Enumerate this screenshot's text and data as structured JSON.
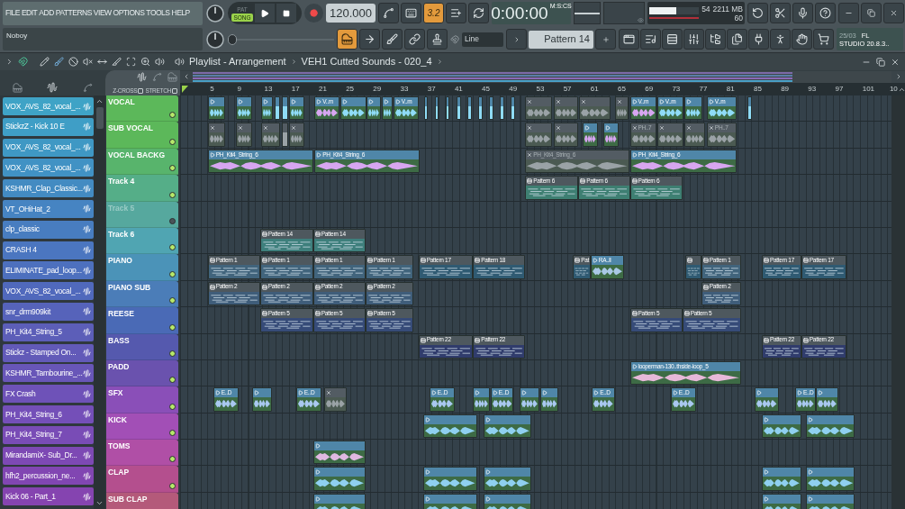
{
  "menu": [
    "FILE",
    "EDIT",
    "ADD",
    "PATTERNS",
    "VIEW",
    "OPTIONS",
    "TOOLS",
    "HELP"
  ],
  "hint_bar": {
    "text": "Noboy"
  },
  "transport": {
    "modes": [
      {
        "label": "PAT",
        "selected": false
      },
      {
        "label": "SONG",
        "selected": true
      }
    ],
    "tempo": "120.000"
  },
  "mode_buttons": [
    {
      "on": false
    },
    {
      "on": false
    },
    {
      "label": "3.2",
      "on": true
    },
    {
      "on": false
    },
    {
      "on": false
    }
  ],
  "time": {
    "value": "0:00:00",
    "unit": "M:S:CS"
  },
  "cpu": {
    "level": 0.54,
    "value": "54",
    "memory": "2211 MB",
    "polyphony": "60"
  },
  "main_volume": {
    "level": 0.0
  },
  "tool_buttons": [
    {
      "on": true
    },
    {
      "on": false
    },
    {
      "on": false
    },
    {
      "on": false
    },
    {
      "on": false
    }
  ],
  "snap": "Line",
  "pattern": "Pattern 14",
  "version": {
    "date": "25/03",
    "lines": [
      "FL",
      "STUDIO 20.8.3.."
    ]
  },
  "playlist": {
    "title": "Playlist - Arrangement",
    "pattern": "VEH1 Cutted Sounds - 020_4",
    "options": [
      {
        "label": "Z-CROSS",
        "checked": false
      },
      {
        "label": "STRETCH",
        "checked": false
      }
    ],
    "ruler": [
      "5",
      "9",
      "13",
      "17",
      "21",
      "25",
      "29",
      "33",
      "37",
      "41",
      "45",
      "49",
      "53",
      "57",
      "61",
      "65",
      "69",
      "73",
      "77",
      "81",
      "85",
      "89",
      "93",
      "97",
      "101",
      "10"
    ]
  },
  "channels": [
    {
      "name": "VOX_AVS_82_vocal_...",
      "color": "#3fa3c6"
    },
    {
      "name": "StickzZ - Kick 10 E",
      "color": "#3f9ec6"
    },
    {
      "name": "VOX_AVS_82_vocal_...",
      "color": "#3f98c4"
    },
    {
      "name": "VOX_AVS_82_vocal_...",
      "color": "#4192c4"
    },
    {
      "name": "KSHMR_Clap_Classic...",
      "color": "#438bc2"
    },
    {
      "name": "VT_OHiHat_2",
      "color": "#4684c2"
    },
    {
      "name": "clp_classic",
      "color": "#487dc0"
    },
    {
      "name": "CRASH 4",
      "color": "#4b76c0"
    },
    {
      "name": "ELIMINATE_pad_loop...",
      "color": "#4d70be"
    },
    {
      "name": "VOX_AVS_82_vocal_...",
      "color": "#5069bc"
    },
    {
      "name": "snr_drm909kit",
      "color": "#5663ba"
    },
    {
      "name": "PH_Kit4_String_5",
      "color": "#5c5eb8"
    },
    {
      "name": "Stickz - Stamped On...",
      "color": "#625ab8"
    },
    {
      "name": "KSHMR_Tambourine_...",
      "color": "#6856b8"
    },
    {
      "name": "FX Crash",
      "color": "#6e52b8"
    },
    {
      "name": "PH_Kit4_String_6",
      "color": "#744fb8"
    },
    {
      "name": "PH_Kit4_String_7",
      "color": "#794cb6"
    },
    {
      "name": "MirandamiX- Sub_Dr...",
      "color": "#7d49b4"
    },
    {
      "name": "hfh2_percussion_ne...",
      "color": "#8146b2"
    },
    {
      "name": "Kick 06 - Part_1",
      "color": "#8544b0"
    }
  ],
  "tracks": [
    {
      "name": "VOCAL",
      "color": "#5cb85a",
      "enabled": true,
      "clips": [
        {
          "kind": "audio",
          "color": "#8fdcf7",
          "muted": false
        },
        {
          "kind": "audio",
          "color": "#8fdcf7",
          "muted": false
        },
        {
          "kind": "audio",
          "color": "#8fdcf7",
          "muted": false
        },
        {
          "kind": "audio",
          "color": "#8fdcf7",
          "muted": false
        },
        {
          "kind": "audio",
          "color": "#8fdcf7",
          "muted": false
        },
        {
          "kind": "audio",
          "color": "#8fdcf7",
          "muted": false
        },
        {
          "kind": "audio",
          "color": "#d7a6f0",
          "muted": false,
          "label": "V..m"
        },
        {
          "kind": "audio",
          "color": "#8fdcf7",
          "muted": false
        },
        {
          "kind": "audio",
          "color": "#8fdcf7",
          "muted": false
        },
        {
          "kind": "audio",
          "color": "#8fdcf7",
          "muted": false
        },
        {
          "kind": "audio",
          "color": "#8fdcf7",
          "muted": false,
          "label": "V..m"
        },
        {
          "kind": "audio",
          "color": "#8fdcf7",
          "muted": false
        },
        {
          "kind": "audio",
          "color": "#8fdcf7",
          "muted": false
        },
        {
          "kind": "audio",
          "color": "#8fdcf7",
          "muted": false
        },
        {
          "kind": "audio",
          "color": "#8fdcf7",
          "muted": false
        },
        {
          "kind": "audio",
          "color": "#8fdcf7",
          "muted": false
        },
        {
          "kind": "audio",
          "color": "#8fdcf7",
          "muted": false
        },
        {
          "kind": "audio",
          "color": "#8fdcf7",
          "muted": false
        },
        {
          "kind": "audio",
          "color": "#8fdcf7",
          "muted": false
        },
        {
          "kind": "audio",
          "color": "#8fdcf7",
          "muted": false
        },
        {
          "kind": "audio",
          "color": "#9aa2a6",
          "muted": true
        },
        {
          "kind": "audio",
          "color": "#9aa2a6",
          "muted": true
        },
        {
          "kind": "audio",
          "color": "#9aa2a6",
          "muted": true
        },
        {
          "kind": "audio",
          "color": "#9aa2a6",
          "muted": true
        },
        {
          "kind": "audio",
          "color": "#d7a6f0",
          "muted": false,
          "label": "V..m"
        },
        {
          "kind": "audio",
          "color": "#8fdcf7",
          "muted": false,
          "label": "V..m"
        },
        {
          "kind": "audio",
          "color": "#8fdcf7",
          "muted": false
        },
        {
          "kind": "audio",
          "color": "#8fdcf7",
          "muted": false,
          "label": "V..m"
        },
        {
          "kind": "audio",
          "color": "#8fdcf7",
          "muted": false
        }
      ]
    },
    {
      "name": "SUB VOCAL",
      "color": "#5cb85a",
      "enabled": true,
      "clips": [
        {
          "kind": "audio",
          "color": "#9aa2a6",
          "muted": true
        },
        {
          "kind": "audio",
          "color": "#9aa2a6",
          "muted": true
        },
        {
          "kind": "audio",
          "color": "#9aa2a6",
          "muted": true
        },
        {
          "kind": "audio",
          "color": "#9aa2a6",
          "muted": true
        },
        {
          "kind": "audio",
          "color": "#9aa2a6",
          "muted": true
        },
        {
          "kind": "audio",
          "color": "#9aa2a6",
          "muted": true
        },
        {
          "kind": "audio",
          "color": "#9aa2a6",
          "muted": true
        },
        {
          "kind": "audio",
          "color": "#d7a6f0",
          "muted": false
        },
        {
          "kind": "audio",
          "color": "#d7a6f0",
          "muted": false
        },
        {
          "kind": "audio",
          "color": "#9aa2a6",
          "muted": true,
          "label": "PH..7"
        },
        {
          "kind": "audio",
          "color": "#9aa2a6",
          "muted": true
        },
        {
          "kind": "audio",
          "color": "#9aa2a6",
          "muted": true
        },
        {
          "kind": "audio",
          "color": "#9aa2a6",
          "muted": true,
          "label": "PH..7"
        }
      ]
    },
    {
      "name": "VOCAL BACKG",
      "color": "#58b46c",
      "enabled": true,
      "clips": [
        {
          "kind": "audio",
          "color": "#d7a6f0",
          "muted": false,
          "label": "PH_Kit4_String_6"
        },
        {
          "kind": "audio",
          "color": "#d7a6f0",
          "muted": false,
          "label": "PH_Kit4_String_6"
        },
        {
          "kind": "audio",
          "color": "#9aa2a6",
          "muted": true,
          "label": "PH_Kit4_String_6"
        },
        {
          "kind": "audio",
          "color": "#d7a6f0",
          "muted": false,
          "label": "PH_Kit4_String_6"
        }
      ]
    },
    {
      "name": "Track 4",
      "color": "#55ae88",
      "enabled": true,
      "clips": [
        {
          "kind": "pattern",
          "color": "#3e7f72",
          "muted": false,
          "label": "Pattern 6"
        },
        {
          "kind": "pattern",
          "color": "#3e7f72",
          "muted": false,
          "label": "Pattern 6"
        },
        {
          "kind": "pattern",
          "color": "#3e7f72",
          "muted": false,
          "label": "Pattern 6"
        }
      ]
    },
    {
      "name": "Track 5",
      "color": "#56a89e",
      "enabled": false
    },
    {
      "name": "Track 6",
      "color": "#50a5b2",
      "enabled": true,
      "clips": [
        {
          "kind": "pattern",
          "color": "#3e7f7c",
          "muted": false,
          "label": "Pattern 14"
        },
        {
          "kind": "pattern",
          "color": "#3e7f7c",
          "muted": false,
          "label": "Pattern 14"
        }
      ]
    },
    {
      "name": "PIANO",
      "color": "#4b93b8",
      "enabled": true,
      "clips": [
        {
          "kind": "pattern",
          "color": "#41647c",
          "muted": false,
          "label": "Pattern 1"
        },
        {
          "kind": "pattern",
          "color": "#41647c",
          "muted": false,
          "label": "Pattern 1"
        },
        {
          "kind": "pattern",
          "color": "#41647c",
          "muted": false,
          "label": "Pattern 1"
        },
        {
          "kind": "pattern",
          "color": "#41647c",
          "muted": false,
          "label": "Pattern 1"
        },
        {
          "kind": "pattern",
          "color": "#2f5a72",
          "muted": false,
          "label": "Pattern 17"
        },
        {
          "kind": "pattern",
          "color": "#2f5a72",
          "muted": false,
          "label": "Pattern 18"
        },
        {
          "kind": "pattern",
          "color": "#2f5a72",
          "muted": false,
          "label": "Pat"
        },
        {
          "kind": "audio",
          "color": "#a9c8e6",
          "muted": false,
          "label": "RA..ll"
        },
        {
          "kind": "pattern",
          "color": "#2f5a72",
          "muted": false
        },
        {
          "kind": "pattern",
          "color": "#41647c",
          "muted": false,
          "label": "Pattern 1"
        },
        {
          "kind": "pattern",
          "color": "#2f5a72",
          "muted": false,
          "label": "Pattern 17"
        },
        {
          "kind": "pattern",
          "color": "#2f5a72",
          "muted": false,
          "label": "Pattern 17"
        }
      ]
    },
    {
      "name": "PIANO SUB",
      "color": "#4b7db8",
      "enabled": true,
      "clips": [
        {
          "kind": "pattern",
          "color": "#3f5d7a",
          "muted": false,
          "label": "Pattern 2"
        },
        {
          "kind": "pattern",
          "color": "#3f5d7a",
          "muted": false,
          "label": "Pattern 2"
        },
        {
          "kind": "pattern",
          "color": "#3f5d7a",
          "muted": false,
          "label": "Pattern 2"
        },
        {
          "kind": "pattern",
          "color": "#3f5d7a",
          "muted": false,
          "label": "Pattern 2"
        },
        {
          "kind": "pattern",
          "color": "#3f5d7a",
          "muted": false,
          "label": "Pattern 2"
        }
      ]
    },
    {
      "name": "REESE",
      "color": "#4a6ab6",
      "enabled": true,
      "clips": [
        {
          "kind": "pattern",
          "color": "#364b78",
          "muted": false,
          "label": "Pattern 5"
        },
        {
          "kind": "pattern",
          "color": "#364b78",
          "muted": false,
          "label": "Pattern 5"
        },
        {
          "kind": "pattern",
          "color": "#364b78",
          "muted": false,
          "label": "Pattern 5"
        },
        {
          "kind": "pattern",
          "color": "#364b78",
          "muted": false,
          "label": "Pattern 5"
        },
        {
          "kind": "pattern",
          "color": "#364b78",
          "muted": false,
          "label": "Pattern 5"
        }
      ]
    },
    {
      "name": "BASS",
      "color": "#5559ae",
      "enabled": true,
      "clips": [
        {
          "kind": "pattern",
          "color": "#303c6c",
          "muted": false,
          "label": "Pattern 22"
        },
        {
          "kind": "pattern",
          "color": "#303c6c",
          "muted": false,
          "label": "Pattern 22"
        },
        {
          "kind": "pattern",
          "color": "#303c6c",
          "muted": false,
          "label": "Pattern 22"
        },
        {
          "kind": "pattern",
          "color": "#303c6c",
          "muted": false,
          "label": "Pattern 22"
        }
      ]
    },
    {
      "name": "PADD",
      "color": "#6a52ae",
      "enabled": true,
      "clips": [
        {
          "kind": "audio",
          "color": "#e6b8d8",
          "muted": false,
          "label": "looperman-130..thside-loop_5"
        }
      ]
    },
    {
      "name": "SFX",
      "color": "#8a4fb8",
      "enabled": true,
      "clips": [
        {
          "kind": "audio",
          "color": "#a9c8f0",
          "muted": false,
          "label": "E..D"
        },
        {
          "kind": "audio",
          "color": "#a9c8f0",
          "muted": false
        },
        {
          "kind": "audio",
          "color": "#a9c8f0",
          "muted": false,
          "label": "E..D"
        },
        {
          "kind": "audio",
          "color": "#9aa2a6",
          "muted": true
        },
        {
          "kind": "audio",
          "color": "#a9c8f0",
          "muted": false,
          "label": "E..D"
        },
        {
          "kind": "audio",
          "color": "#a9c8f0",
          "muted": false
        },
        {
          "kind": "audio",
          "color": "#a9c8f0",
          "muted": false,
          "label": "E..D"
        },
        {
          "kind": "audio",
          "color": "#a9c8f0",
          "muted": false
        },
        {
          "kind": "audio",
          "color": "#a9c8f0",
          "muted": false
        },
        {
          "kind": "audio",
          "color": "#a9c8f0",
          "muted": false,
          "label": "E..D"
        },
        {
          "kind": "audio",
          "color": "#a9c8f0",
          "muted": false,
          "label": "E..D"
        },
        {
          "kind": "audio",
          "color": "#a9c8f0",
          "muted": false
        },
        {
          "kind": "audio",
          "color": "#a9c8f0",
          "muted": false,
          "label": "E..D"
        },
        {
          "kind": "audio",
          "color": "#a9c8f0",
          "muted": false
        }
      ]
    },
    {
      "name": "KICK",
      "color": "#a24fb6",
      "enabled": true,
      "clips": [
        {
          "kind": "audio",
          "color": "#8fd0f0",
          "muted": false
        },
        {
          "kind": "audio",
          "color": "#8fd0f0",
          "muted": false
        },
        {
          "kind": "audio",
          "color": "#8fd0f0",
          "muted": false
        },
        {
          "kind": "audio",
          "color": "#8fd0f0",
          "muted": false
        }
      ]
    },
    {
      "name": "TOMS",
      "color": "#b04fa6",
      "enabled": true,
      "clips": [
        {
          "kind": "audio",
          "color": "#e0b8e0",
          "muted": false
        }
      ]
    },
    {
      "name": "CLAP",
      "color": "#b44f8e",
      "enabled": true,
      "clips": [
        {
          "kind": "audio",
          "color": "#8fd0f0",
          "muted": false
        },
        {
          "kind": "audio",
          "color": "#8fd0f0",
          "muted": false
        },
        {
          "kind": "audio",
          "color": "#8fd0f0",
          "muted": false
        },
        {
          "kind": "audio",
          "color": "#8fd0f0",
          "muted": false
        },
        {
          "kind": "audio",
          "color": "#8fd0f0",
          "muted": false
        }
      ]
    },
    {
      "name": "SUB CLAP",
      "color": "#b45a7a",
      "enabled": true,
      "clips": [
        {
          "kind": "audio",
          "color": "#8fd0f0",
          "muted": false
        },
        {
          "kind": "audio",
          "color": "#8fd0f0",
          "muted": false
        },
        {
          "kind": "audio",
          "color": "#8fd0f0",
          "muted": false
        },
        {
          "kind": "audio",
          "color": "#8fd0f0",
          "muted": false
        },
        {
          "kind": "audio",
          "color": "#8fd0f0",
          "muted": false
        }
      ]
    }
  ]
}
